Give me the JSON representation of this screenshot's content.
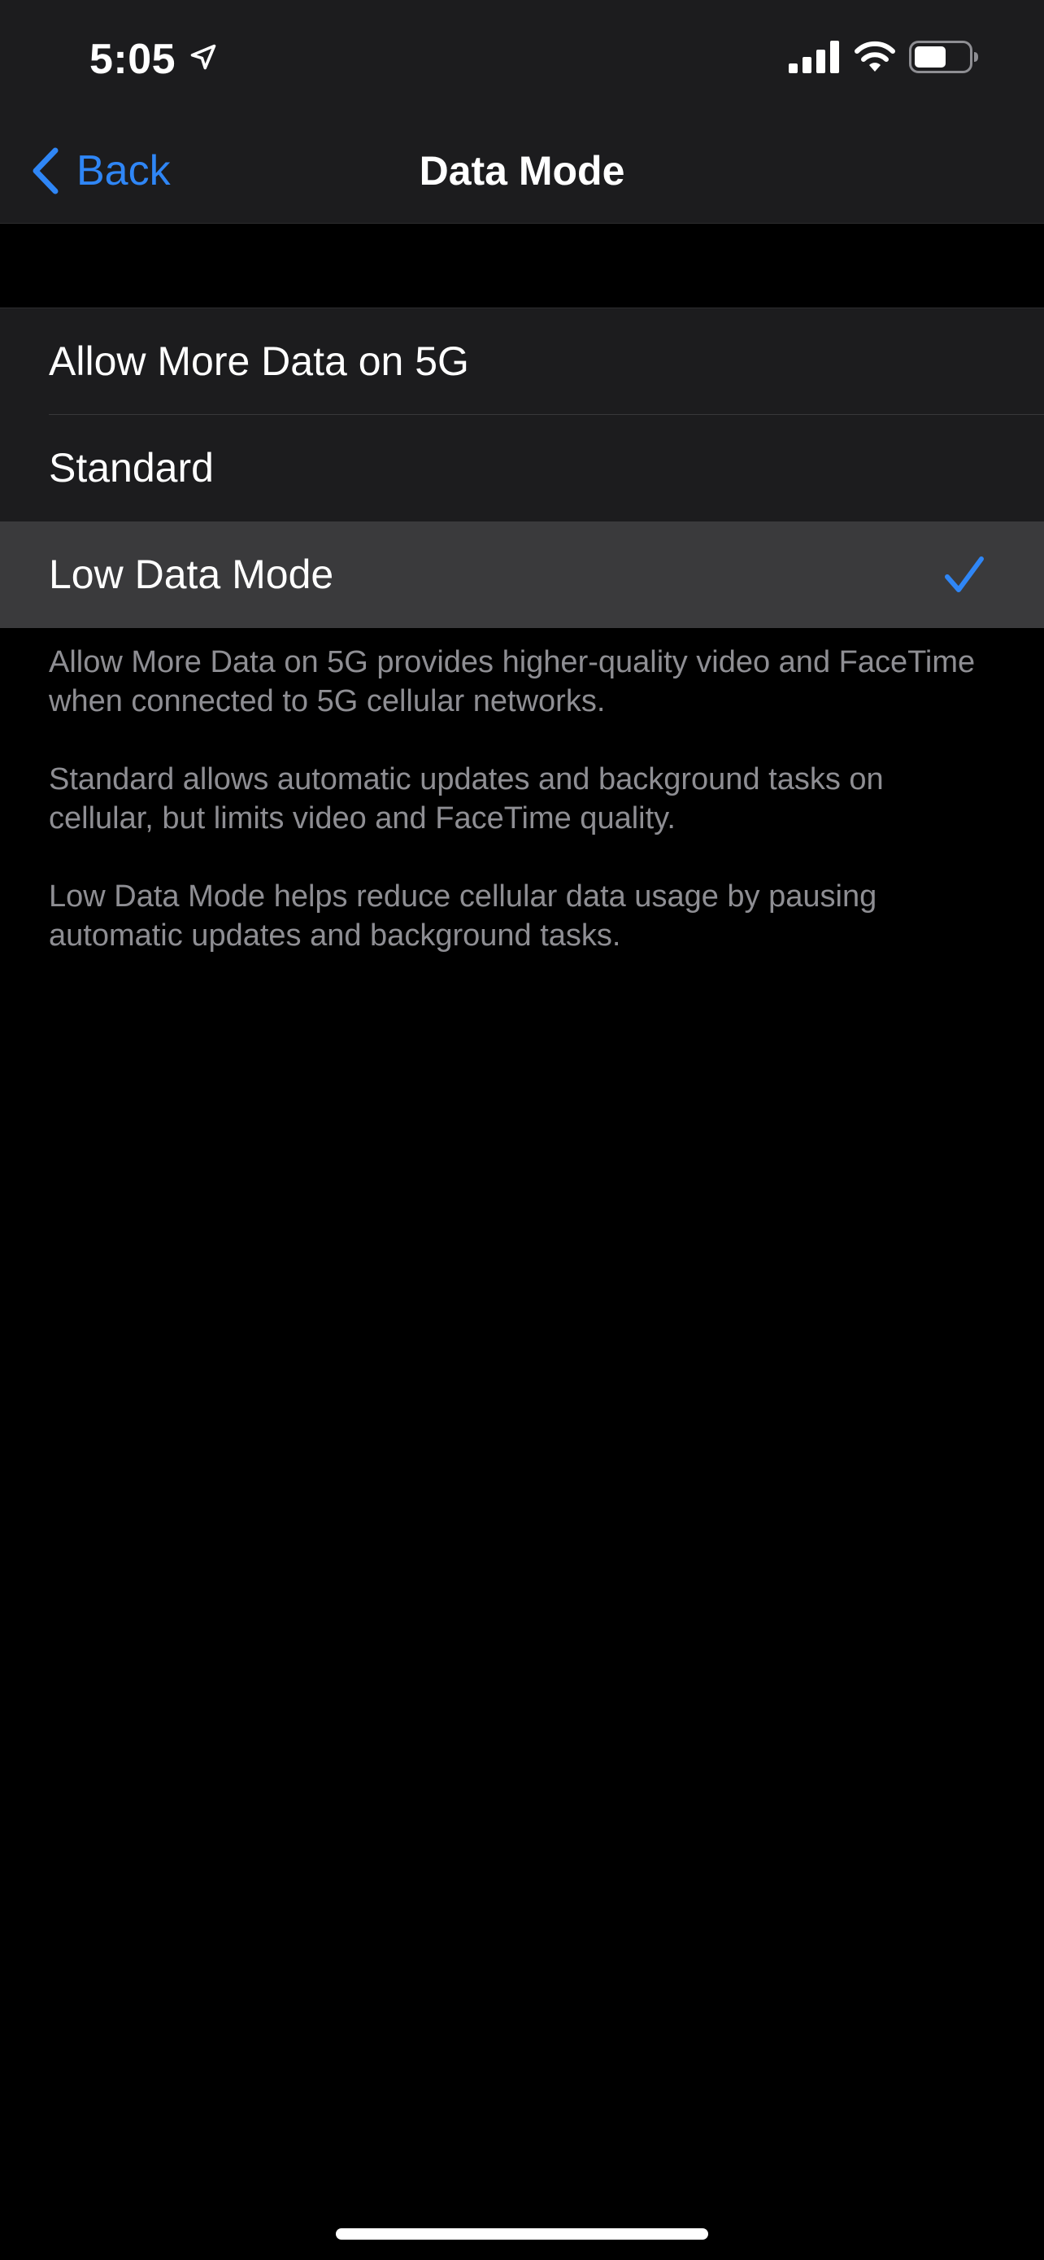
{
  "status_bar": {
    "time": "5:05",
    "icons": [
      "location-arrow-icon",
      "cellular-signal-icon",
      "wifi-icon",
      "battery-icon"
    ]
  },
  "nav": {
    "back_label": "Back",
    "title": "Data Mode"
  },
  "options": [
    {
      "label": "Allow More Data on 5G",
      "selected": false
    },
    {
      "label": "Standard",
      "selected": false
    },
    {
      "label": "Low Data Mode",
      "selected": true
    }
  ],
  "footer": {
    "paragraphs": [
      "Allow More Data on 5G provides higher-quality video and FaceTime when connected to 5G cellular networks.",
      "Standard allows automatic updates and background tasks on cellular, but limits video and FaceTime quality.",
      "Low Data Mode helps reduce cellular data usage by pausing automatic updates and background tasks."
    ]
  },
  "colors": {
    "accent": "#2f86f6",
    "background": "#000000",
    "grouped_cell": "#1c1c1e",
    "selected_cell": "#3a3a3c",
    "secondary_text": "#8e8e93"
  }
}
